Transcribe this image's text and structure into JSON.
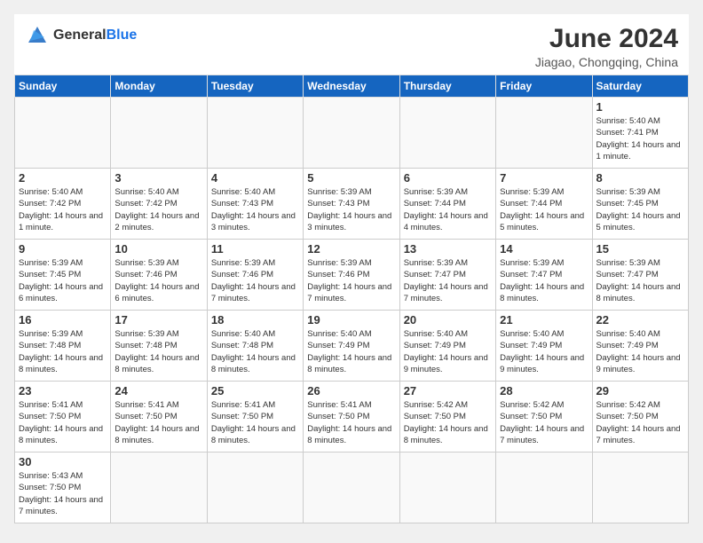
{
  "header": {
    "logo_general": "General",
    "logo_blue": "Blue",
    "month_title": "June 2024",
    "location": "Jiagao, Chongqing, China"
  },
  "days_of_week": [
    "Sunday",
    "Monday",
    "Tuesday",
    "Wednesday",
    "Thursday",
    "Friday",
    "Saturday"
  ],
  "weeks": [
    [
      {
        "day": "",
        "info": ""
      },
      {
        "day": "",
        "info": ""
      },
      {
        "day": "",
        "info": ""
      },
      {
        "day": "",
        "info": ""
      },
      {
        "day": "",
        "info": ""
      },
      {
        "day": "",
        "info": ""
      },
      {
        "day": "1",
        "info": "Sunrise: 5:40 AM\nSunset: 7:41 PM\nDaylight: 14 hours and 1 minute."
      }
    ],
    [
      {
        "day": "2",
        "info": "Sunrise: 5:40 AM\nSunset: 7:42 PM\nDaylight: 14 hours and 1 minute."
      },
      {
        "day": "3",
        "info": "Sunrise: 5:40 AM\nSunset: 7:42 PM\nDaylight: 14 hours and 2 minutes."
      },
      {
        "day": "4",
        "info": "Sunrise: 5:40 AM\nSunset: 7:43 PM\nDaylight: 14 hours and 3 minutes."
      },
      {
        "day": "5",
        "info": "Sunrise: 5:39 AM\nSunset: 7:43 PM\nDaylight: 14 hours and 3 minutes."
      },
      {
        "day": "6",
        "info": "Sunrise: 5:39 AM\nSunset: 7:44 PM\nDaylight: 14 hours and 4 minutes."
      },
      {
        "day": "7",
        "info": "Sunrise: 5:39 AM\nSunset: 7:44 PM\nDaylight: 14 hours and 5 minutes."
      },
      {
        "day": "8",
        "info": "Sunrise: 5:39 AM\nSunset: 7:45 PM\nDaylight: 14 hours and 5 minutes."
      }
    ],
    [
      {
        "day": "9",
        "info": "Sunrise: 5:39 AM\nSunset: 7:45 PM\nDaylight: 14 hours and 6 minutes."
      },
      {
        "day": "10",
        "info": "Sunrise: 5:39 AM\nSunset: 7:46 PM\nDaylight: 14 hours and 6 minutes."
      },
      {
        "day": "11",
        "info": "Sunrise: 5:39 AM\nSunset: 7:46 PM\nDaylight: 14 hours and 7 minutes."
      },
      {
        "day": "12",
        "info": "Sunrise: 5:39 AM\nSunset: 7:46 PM\nDaylight: 14 hours and 7 minutes."
      },
      {
        "day": "13",
        "info": "Sunrise: 5:39 AM\nSunset: 7:47 PM\nDaylight: 14 hours and 7 minutes."
      },
      {
        "day": "14",
        "info": "Sunrise: 5:39 AM\nSunset: 7:47 PM\nDaylight: 14 hours and 8 minutes."
      },
      {
        "day": "15",
        "info": "Sunrise: 5:39 AM\nSunset: 7:47 PM\nDaylight: 14 hours and 8 minutes."
      }
    ],
    [
      {
        "day": "16",
        "info": "Sunrise: 5:39 AM\nSunset: 7:48 PM\nDaylight: 14 hours and 8 minutes."
      },
      {
        "day": "17",
        "info": "Sunrise: 5:39 AM\nSunset: 7:48 PM\nDaylight: 14 hours and 8 minutes."
      },
      {
        "day": "18",
        "info": "Sunrise: 5:40 AM\nSunset: 7:48 PM\nDaylight: 14 hours and 8 minutes."
      },
      {
        "day": "19",
        "info": "Sunrise: 5:40 AM\nSunset: 7:49 PM\nDaylight: 14 hours and 8 minutes."
      },
      {
        "day": "20",
        "info": "Sunrise: 5:40 AM\nSunset: 7:49 PM\nDaylight: 14 hours and 9 minutes."
      },
      {
        "day": "21",
        "info": "Sunrise: 5:40 AM\nSunset: 7:49 PM\nDaylight: 14 hours and 9 minutes."
      },
      {
        "day": "22",
        "info": "Sunrise: 5:40 AM\nSunset: 7:49 PM\nDaylight: 14 hours and 9 minutes."
      }
    ],
    [
      {
        "day": "23",
        "info": "Sunrise: 5:41 AM\nSunset: 7:50 PM\nDaylight: 14 hours and 8 minutes."
      },
      {
        "day": "24",
        "info": "Sunrise: 5:41 AM\nSunset: 7:50 PM\nDaylight: 14 hours and 8 minutes."
      },
      {
        "day": "25",
        "info": "Sunrise: 5:41 AM\nSunset: 7:50 PM\nDaylight: 14 hours and 8 minutes."
      },
      {
        "day": "26",
        "info": "Sunrise: 5:41 AM\nSunset: 7:50 PM\nDaylight: 14 hours and 8 minutes."
      },
      {
        "day": "27",
        "info": "Sunrise: 5:42 AM\nSunset: 7:50 PM\nDaylight: 14 hours and 8 minutes."
      },
      {
        "day": "28",
        "info": "Sunrise: 5:42 AM\nSunset: 7:50 PM\nDaylight: 14 hours and 7 minutes."
      },
      {
        "day": "29",
        "info": "Sunrise: 5:42 AM\nSunset: 7:50 PM\nDaylight: 14 hours and 7 minutes."
      }
    ],
    [
      {
        "day": "30",
        "info": "Sunrise: 5:43 AM\nSunset: 7:50 PM\nDaylight: 14 hours and 7 minutes."
      },
      {
        "day": "",
        "info": ""
      },
      {
        "day": "",
        "info": ""
      },
      {
        "day": "",
        "info": ""
      },
      {
        "day": "",
        "info": ""
      },
      {
        "day": "",
        "info": ""
      },
      {
        "day": "",
        "info": ""
      }
    ]
  ]
}
